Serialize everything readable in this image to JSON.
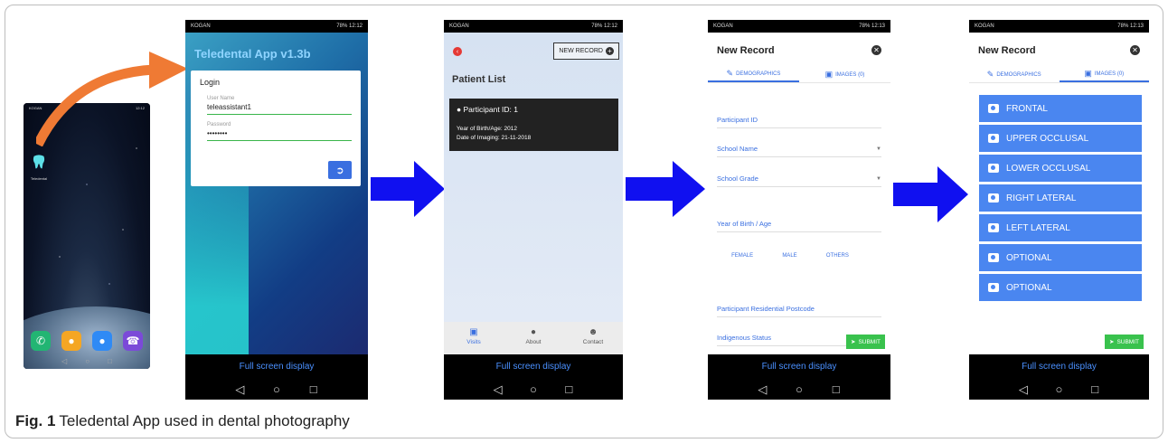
{
  "caption": {
    "label": "Fig. 1",
    "text": "Teledental App used in dental photography"
  },
  "colors": {
    "arrow_blue": "#1010f0",
    "arrow_orange": "#ef7a34",
    "button_blue": "#4a86f0",
    "submit_green": "#39c24d",
    "accent": "#3a6fe0"
  },
  "status": {
    "carrier": "KOGAN",
    "battery": "78%",
    "time_1": "12:12",
    "time_2": "12:13"
  },
  "home": {
    "app_label": "Teledental"
  },
  "system": {
    "full_screen": "Full screen display"
  },
  "login": {
    "app_title": "Teledental App v1.3b",
    "heading": "Login",
    "username_label": "User Name",
    "username_value": "teleassistant1",
    "password_label": "Password",
    "password_value": "••••••••"
  },
  "patient_list": {
    "new_record_label": "NEW RECORD",
    "title": "Patient List",
    "participant": "Participant ID: 1",
    "birth": "Year of Birth/Age: 2012",
    "imaging": "Date of Imaging: 21-11-2018",
    "tabs": [
      {
        "label": "Visits",
        "icon": "book-icon"
      },
      {
        "label": "About",
        "icon": "info-icon"
      },
      {
        "label": "Contact",
        "icon": "contacts-icon"
      }
    ]
  },
  "new_record": {
    "title": "New Record",
    "tab_demographics": "DEMOGRAPHICS",
    "tab_images": "IMAGES (0)",
    "fields": {
      "participant_id": "Participant ID",
      "school_name": "School Name",
      "school_grade": "School Grade",
      "year_of_birth": "Year of Birth / Age",
      "postcode": "Participant Residential Postcode",
      "indigenous": "Indigenous Status"
    },
    "gender": [
      "FEMALE",
      "MALE",
      "OTHERS"
    ],
    "submit": "SUBMIT",
    "image_buttons": [
      "FRONTAL",
      "UPPER OCCLUSAL",
      "LOWER OCCLUSAL",
      "RIGHT LATERAL",
      "LEFT LATERAL",
      "OPTIONAL",
      "OPTIONAL"
    ]
  }
}
